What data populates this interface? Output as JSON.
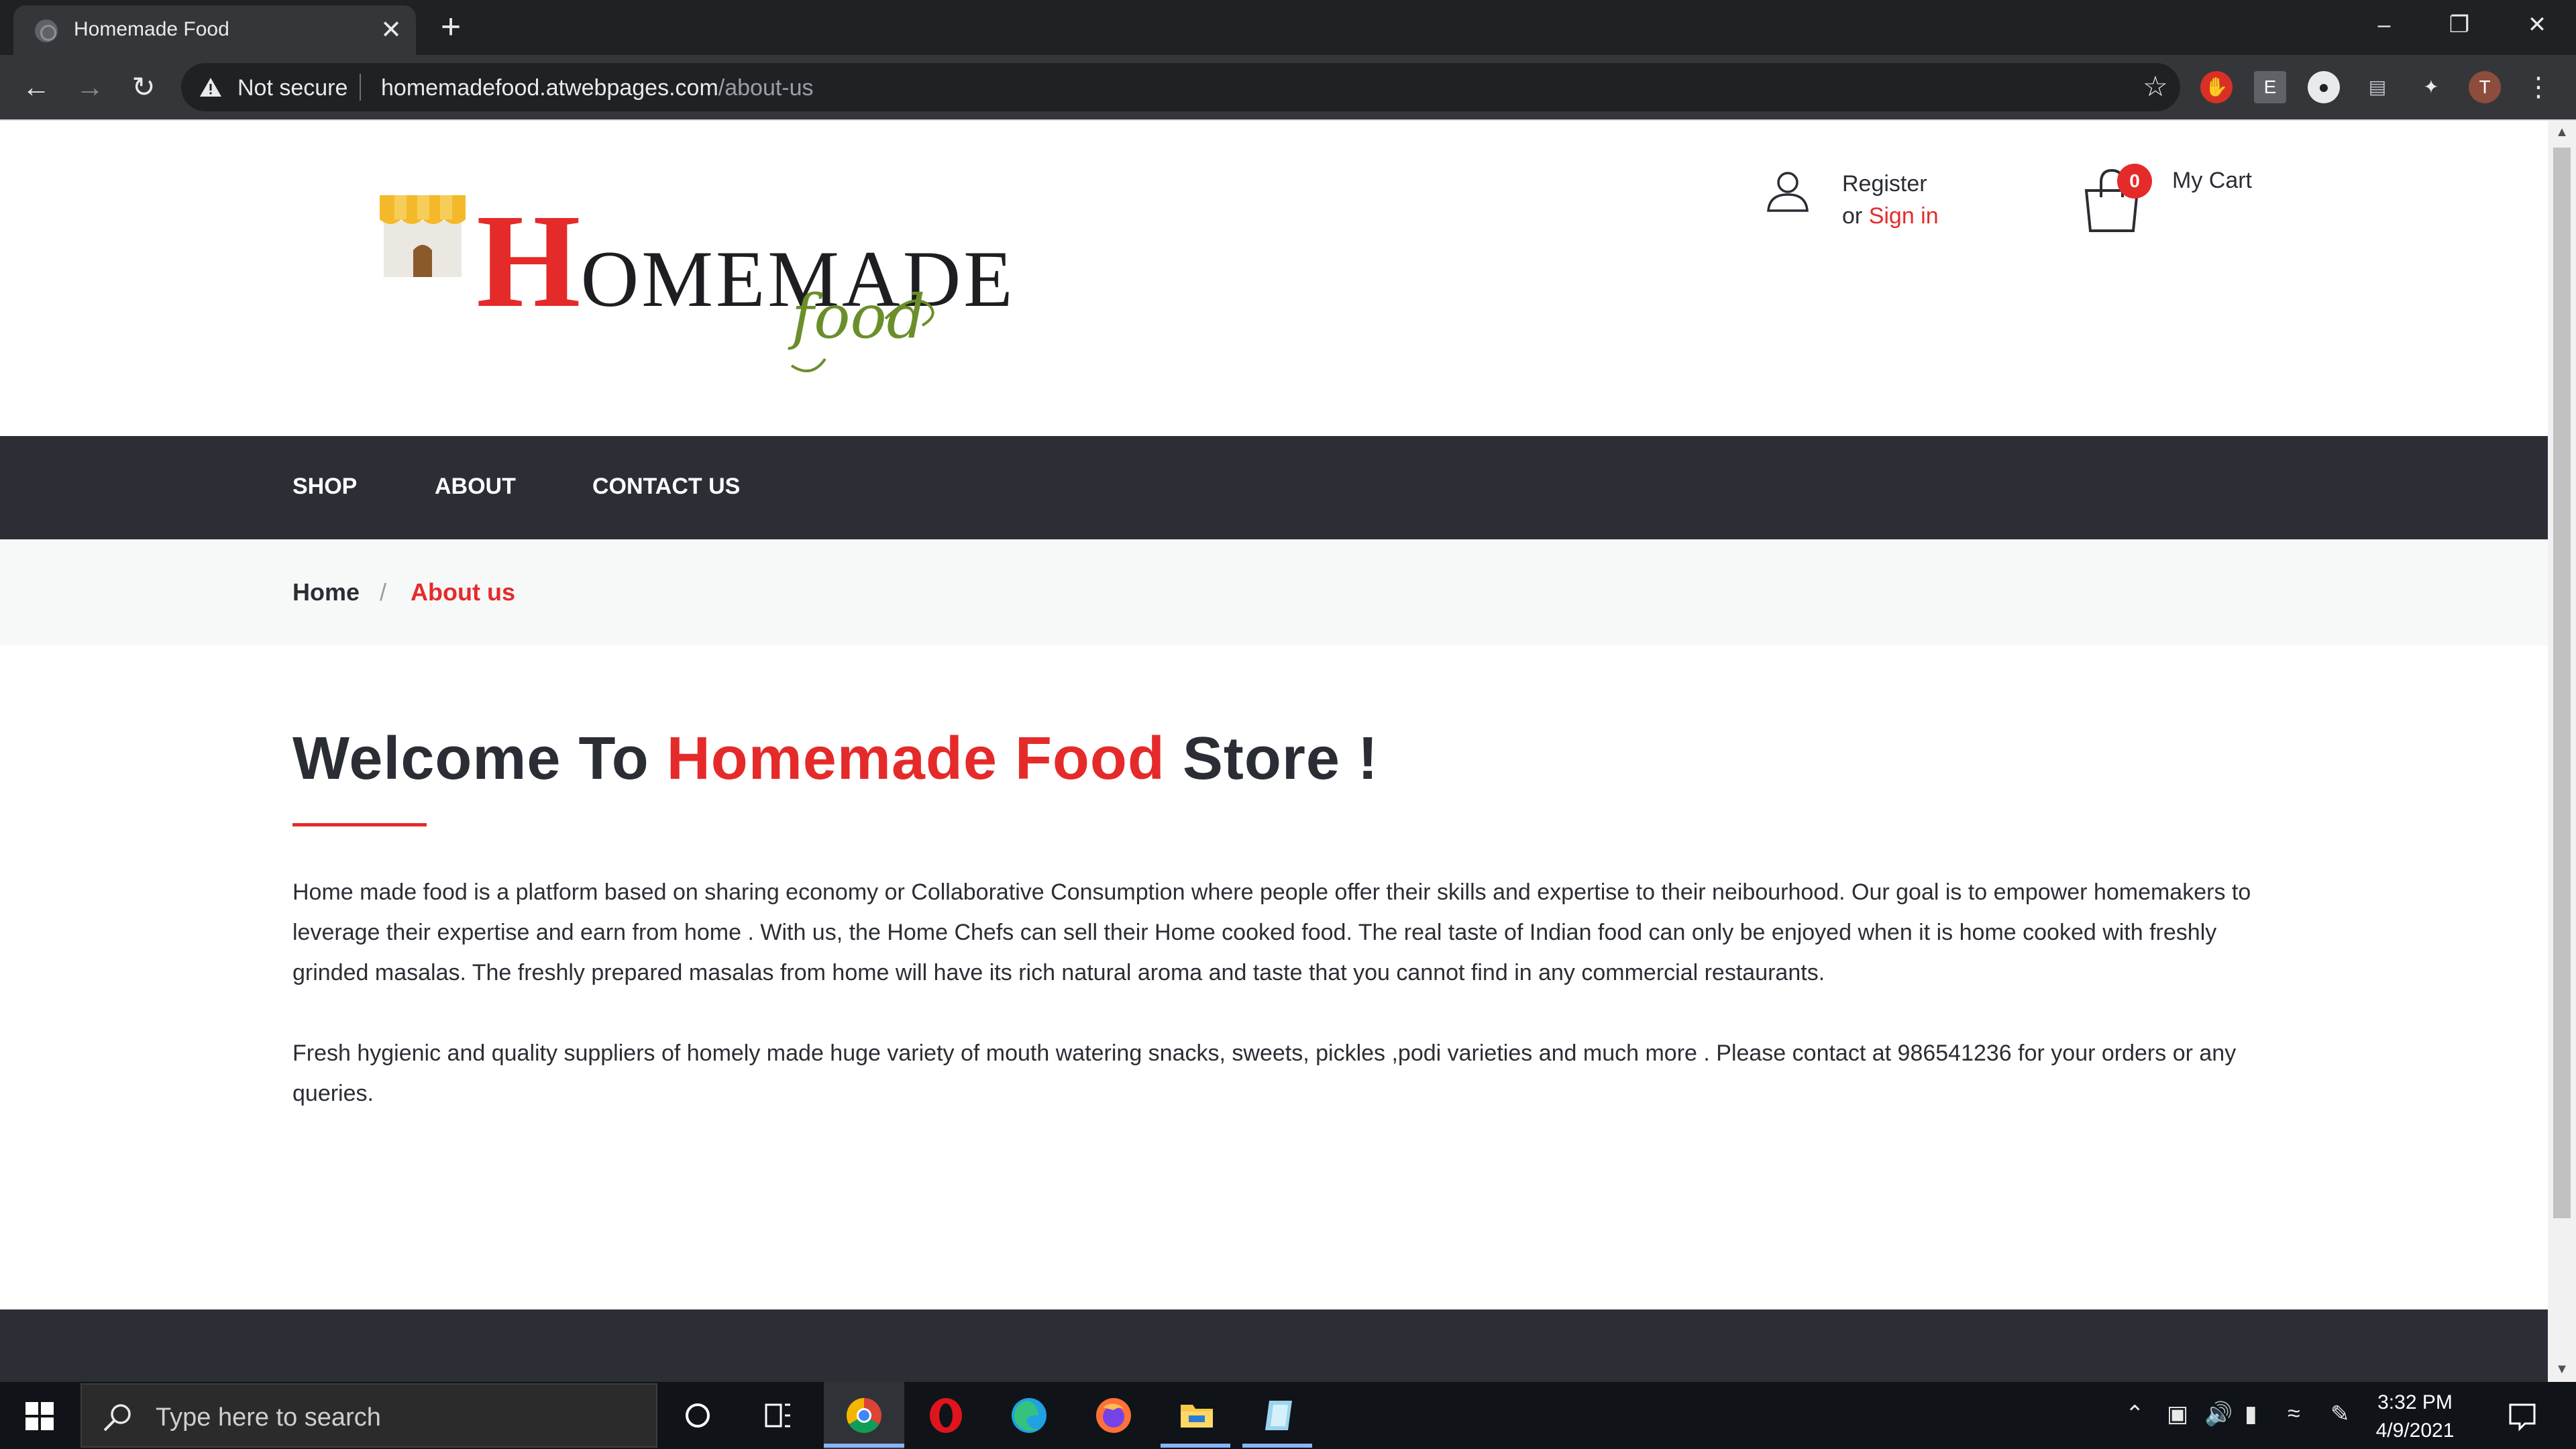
{
  "browser": {
    "tab_title": "Homemade Food",
    "tab_close": "✕",
    "new_tab": "+",
    "security_label": "Not secure",
    "url_host": "homemadefood.atwebpages.com",
    "url_path": "/about-us",
    "profile_initial": "T",
    "ext_e": "E"
  },
  "header": {
    "logo_h": "H",
    "logo_rest": "OMEMADE",
    "logo_food": "food",
    "register": "Register",
    "or": "or ",
    "sign_in": "Sign in",
    "cart_count": "0",
    "cart_label": "My Cart"
  },
  "nav": {
    "items": [
      {
        "label": "SHOP"
      },
      {
        "label": "ABOUT"
      },
      {
        "label": "CONTACT US"
      }
    ]
  },
  "breadcrumb": {
    "home": "Home",
    "separator": "/",
    "current": "About us"
  },
  "main": {
    "heading_pre": "Welcome To ",
    "heading_highlight": "Homemade Food",
    "heading_post": " Store !",
    "paragraph1": "Home made food is a platform based on sharing economy or Collaborative Consumption where people offer their skills and expertise to their neibourhood. Our goal is to empower homemakers to leverage their expertise and earn from home . With us, the Home Chefs can sell their Home cooked food. The real taste of Indian food can only be enjoyed when it is home cooked with freshly grinded masalas. The freshly prepared masalas from home will have its rich natural aroma and taste that you cannot find in any commercial restaurants.",
    "paragraph2": "Fresh hygienic and quality suppliers of homely made huge variety of mouth watering snacks, sweets, pickles ,podi varieties and much more . Please contact at 986541236 for your orders or any queries."
  },
  "taskbar": {
    "search_placeholder": "Type here to search",
    "time": "3:32 PM",
    "date": "4/9/2021"
  },
  "colors": {
    "accent_red": "#e52a2a",
    "dark_nav": "#2b2e35",
    "logo_green": "#6a8f2a"
  }
}
